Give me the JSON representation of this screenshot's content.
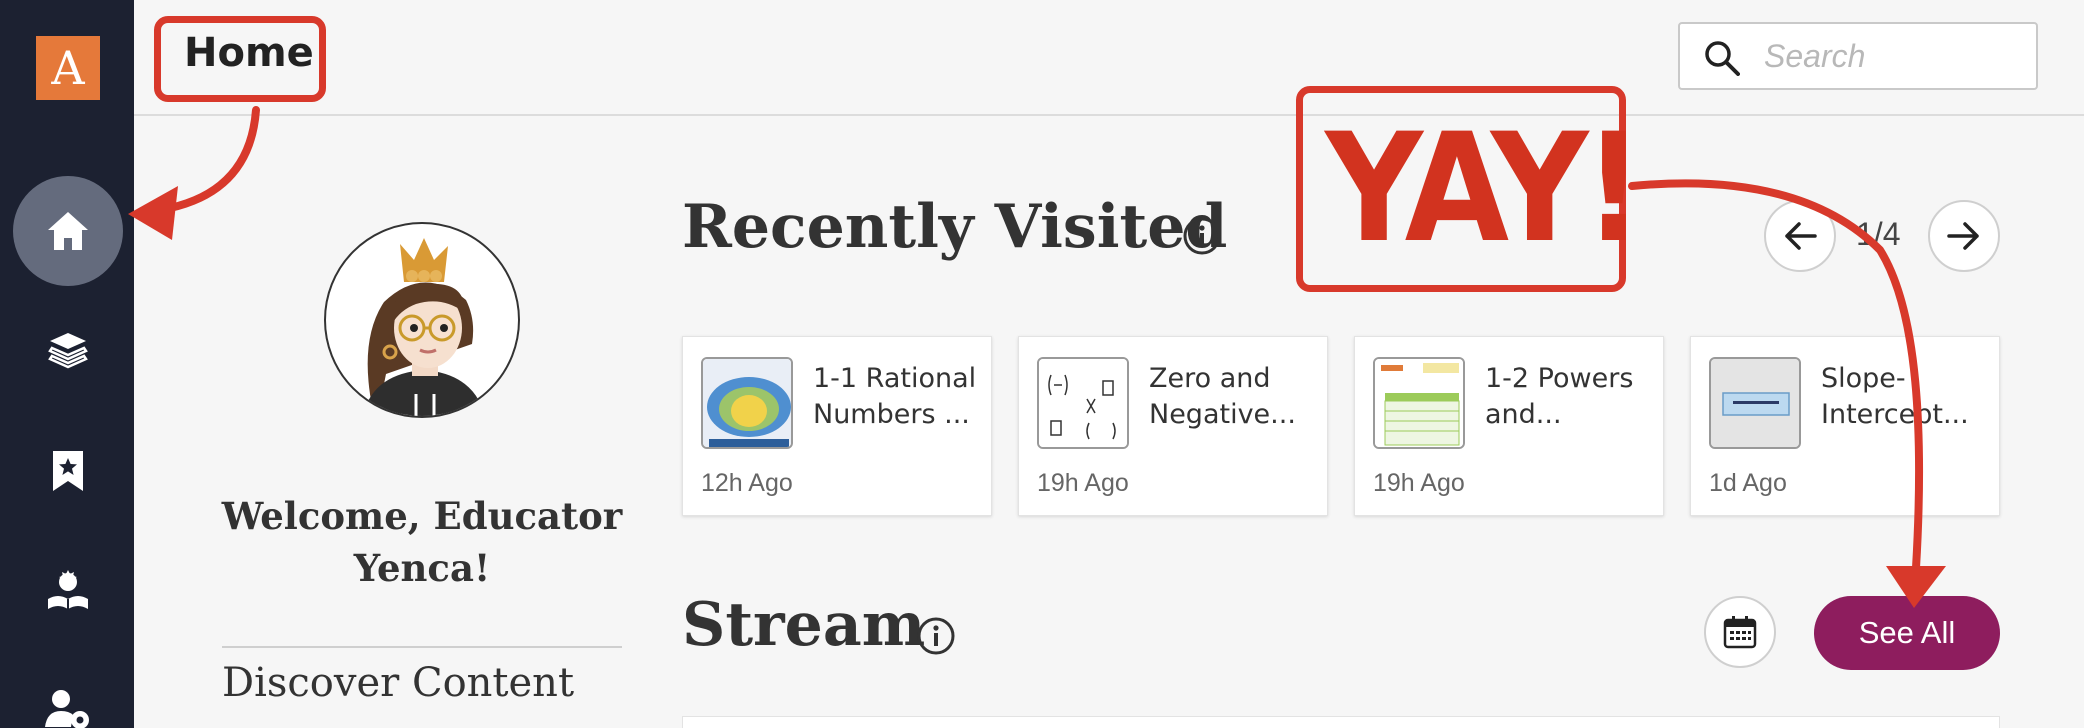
{
  "app": {
    "logo_letter": "A",
    "logo_color": "#e5793a",
    "sidebar_color": "#1c2131"
  },
  "sidebar": {
    "items": [
      {
        "name": "home",
        "icon": "home-icon",
        "active": true
      },
      {
        "name": "library",
        "icon": "layers-icon",
        "active": false
      },
      {
        "name": "bookmarks",
        "icon": "bookmark-star-icon",
        "active": false
      },
      {
        "name": "teacher",
        "icon": "teacher-reading-icon",
        "active": false
      },
      {
        "name": "admin",
        "icon": "user-gear-icon",
        "active": false
      }
    ]
  },
  "header": {
    "title": "Home",
    "search_placeholder": "Search"
  },
  "profile": {
    "welcome": "Welcome, Educator Yenca!",
    "discover": "Discover Content"
  },
  "recently_visited": {
    "title": "Recently Visited",
    "pager": "1/4",
    "cards": [
      {
        "title": "1-1 Rational\nNumbers ...",
        "time": "12h Ago",
        "thumb": "venn-diagram"
      },
      {
        "title": "Zero and\nNegative...",
        "time": "19h Ago",
        "thumb": "exponents"
      },
      {
        "title": "1-2 Powers\nand...",
        "time": "19h Ago",
        "thumb": "worksheet"
      },
      {
        "title": "Slope-\nIntercept...",
        "time": "1d Ago",
        "thumb": "slope-formula"
      }
    ]
  },
  "stream": {
    "title": "Stream",
    "see_all": "See All",
    "see_all_color": "#8e1d5e"
  },
  "annotations": {
    "yay": "YAY!",
    "color": "#d8392b"
  }
}
